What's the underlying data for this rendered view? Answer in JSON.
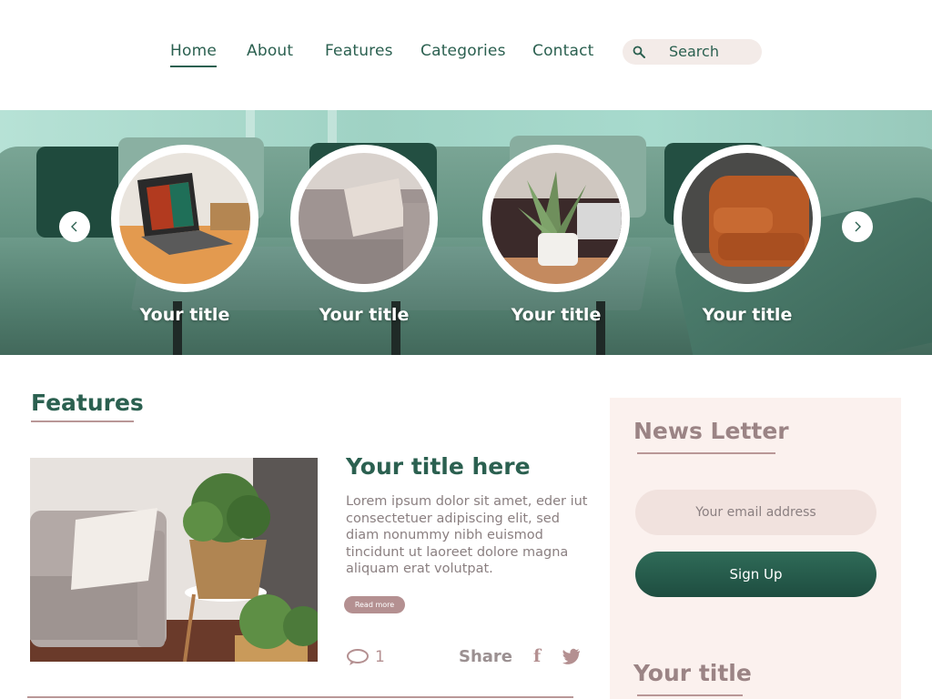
{
  "nav": {
    "items": [
      {
        "label": "Home",
        "active": true
      },
      {
        "label": "About",
        "active": false
      },
      {
        "label": "Features",
        "active": false
      },
      {
        "label": "Categories",
        "active": false
      },
      {
        "label": "Contact",
        "active": false
      }
    ],
    "search_label": "Search",
    "search_icon": "search-icon"
  },
  "hero": {
    "prev_icon": "chevron-left-icon",
    "next_icon": "chevron-right-icon",
    "cards": [
      {
        "title": "Your title",
        "image": "laptop-on-table"
      },
      {
        "title": "Your title",
        "image": "sofa-with-pillow"
      },
      {
        "title": "Your title",
        "image": "potted-aloe-plant"
      },
      {
        "title": "Your title",
        "image": "leather-armchair"
      }
    ]
  },
  "features": {
    "heading": "Features",
    "post": {
      "title": "Your title here",
      "body": "Lorem ipsum dolor sit amet, eder iut consectetuer adipiscing elit, sed diam nonummy nibh euismod tincidunt ut laoreet dolore magna aliquam erat volutpat.",
      "read_more": "Read more",
      "comment_count": "1",
      "share_label": "Share",
      "share_icons": [
        "facebook-icon",
        "twitter-icon"
      ]
    }
  },
  "sidebar": {
    "newsletter_heading": "News Letter",
    "email_placeholder": "Your email address",
    "signup_label": "Sign Up",
    "section_title": "Your title"
  },
  "colors": {
    "primary": "#2b6050",
    "accent_pink": "#b49091",
    "sidebar_bg": "#fbf1ee",
    "input_bg": "#f1e2de"
  }
}
